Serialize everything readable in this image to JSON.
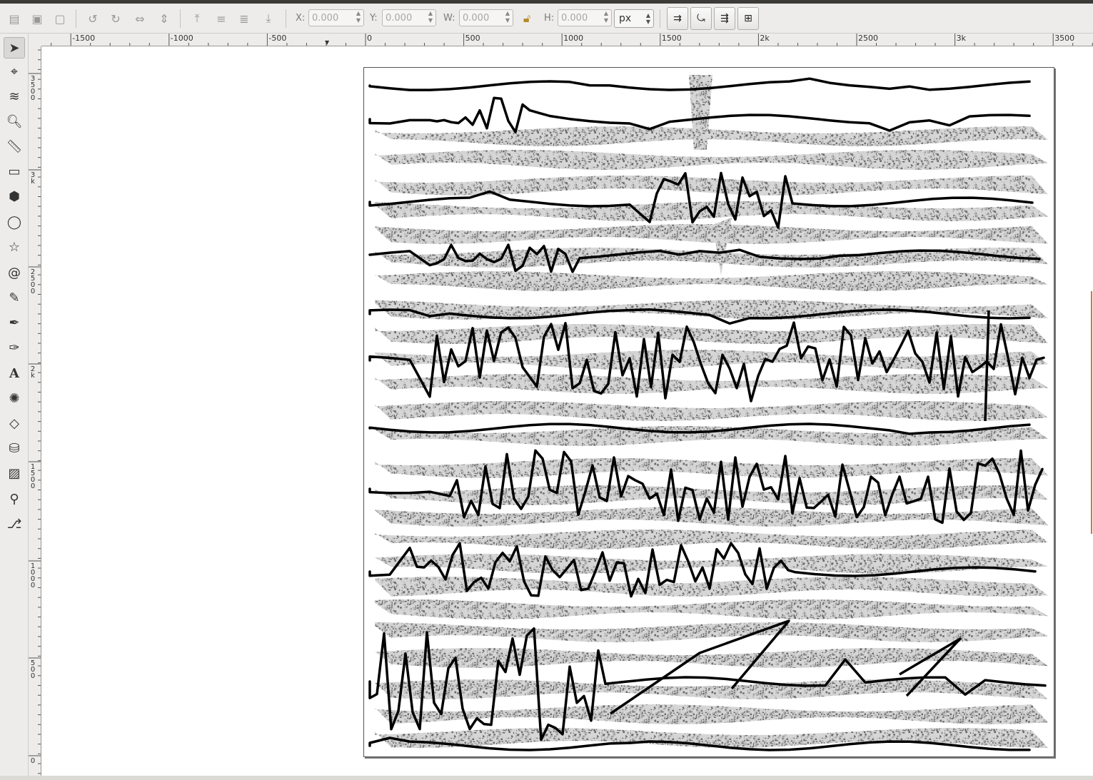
{
  "toolbar": {
    "x_label": "X:",
    "x_value": "0.000",
    "y_label": "Y:",
    "y_value": "0.000",
    "w_label": "W:",
    "w_value": "0.000",
    "h_label": "H:",
    "h_value": "0.000",
    "unit": "px"
  },
  "hruler": {
    "labels": [
      "-1500",
      "-1000",
      "-500",
      "0",
      "500",
      "1000",
      "1500",
      "2k",
      "2500",
      "3k",
      "3500"
    ]
  },
  "vruler": {
    "labels": [
      "3500",
      "3k",
      "2500",
      "2k",
      "1500",
      "1000",
      "500",
      "0"
    ]
  },
  "tools": [
    "selector-tool",
    "node-tool",
    "tweak-tool",
    "zoom-tool",
    "measure-tool",
    "rectangle-tool",
    "3d-box-tool",
    "ellipse-tool",
    "star-tool",
    "spiral-tool",
    "pencil-tool",
    "pen-tool",
    "calligraphy-tool",
    "text-tool",
    "spray-tool",
    "eraser-tool",
    "paint-bucket-tool",
    "gradient-tool",
    "dropper-tool",
    "connector-tool"
  ],
  "colors": {
    "stroke": "#000000",
    "stipple": "#9a9a9a",
    "chrome": "#edeceb"
  }
}
